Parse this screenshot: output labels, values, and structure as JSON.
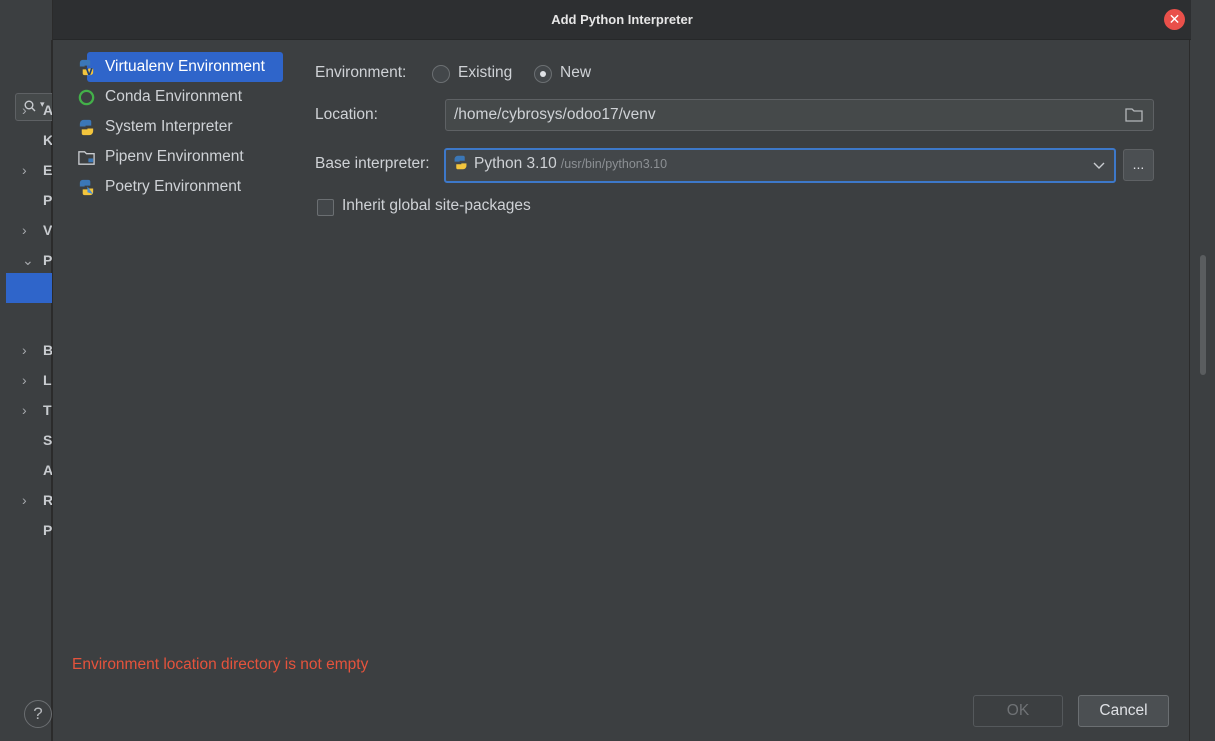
{
  "dialog": {
    "title": "Add Python Interpreter",
    "close_icon": "close-icon"
  },
  "env_list": [
    {
      "label": "Virtualenv Environment",
      "icon": "virtualenv-icon",
      "selected": true
    },
    {
      "label": "Conda Environment",
      "icon": "conda-icon",
      "selected": false
    },
    {
      "label": "System Interpreter",
      "icon": "python-icon",
      "selected": false
    },
    {
      "label": "Pipenv Environment",
      "icon": "pipenv-icon",
      "selected": false
    },
    {
      "label": "Poetry Environment",
      "icon": "poetry-icon",
      "selected": false
    }
  ],
  "form": {
    "environment_label": "Environment:",
    "existing_label": "Existing",
    "new_label": "New",
    "environment_selected": "New",
    "location_label": "Location:",
    "location_value": "/home/cybrosys/odoo17/venv",
    "base_interpreter_label": "Base interpreter:",
    "base_interpreter_name": "Python 3.10",
    "base_interpreter_path": "/usr/bin/python3.10",
    "browse_label": "...",
    "inherit_label": "Inherit global site-packages",
    "inherit_checked": false
  },
  "error": "Environment location directory is not empty",
  "buttons": {
    "ok": "OK",
    "cancel": "Cancel"
  },
  "background": {
    "tree_letters": [
      "A",
      "K",
      "E",
      "P",
      "V",
      "P",
      "B",
      "L",
      "T",
      "S",
      "A",
      "R",
      "P"
    ],
    "help": "?"
  },
  "colors": {
    "accent": "#2f65ca",
    "error": "#e5533c",
    "close": "#e9504a"
  }
}
